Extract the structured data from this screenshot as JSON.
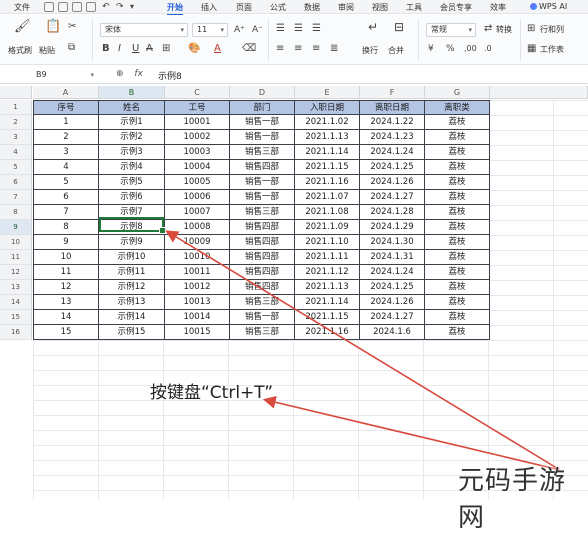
{
  "ribbon_tabs": [
    "文件",
    "开始",
    "插入",
    "页面",
    "公式",
    "数据",
    "审阅",
    "视图",
    "工具",
    "会员专享",
    "效率"
  ],
  "active_tab": "开始",
  "wps_ai": "WPS AI",
  "toolbar": {
    "format_painter": "格式刷",
    "paste": "粘贴",
    "font_name": "宋体",
    "font_size": "11",
    "wrap": "换行",
    "merge": "合并",
    "number_format": "常规",
    "convert": "转换",
    "row_col": "行和列",
    "worksheet": "工作表"
  },
  "formula_bar": {
    "cell_ref": "B9",
    "content": "示例8"
  },
  "columns": [
    "A",
    "B",
    "C",
    "D",
    "E",
    "F",
    "G"
  ],
  "selected_column": "B",
  "row_numbers": [
    "1",
    "2",
    "3",
    "4",
    "5",
    "6",
    "7",
    "8",
    "9",
    "10",
    "11",
    "12",
    "13",
    "14",
    "15",
    "16"
  ],
  "selected_row": "9",
  "table": {
    "headers": [
      "序号",
      "姓名",
      "工号",
      "部门",
      "入职日期",
      "离职日期",
      "离职类"
    ],
    "rows": [
      [
        "1",
        "示例1",
        "10001",
        "销售一部",
        "2021.1.02",
        "2024.1.22",
        "荔枝"
      ],
      [
        "2",
        "示例2",
        "10002",
        "销售一部",
        "2021.1.13",
        "2024.1.23",
        "荔枝"
      ],
      [
        "3",
        "示例3",
        "10003",
        "销售三部",
        "2021.1.14",
        "2024.1.24",
        "荔枝"
      ],
      [
        "4",
        "示例4",
        "10004",
        "销售四部",
        "2021.1.15",
        "2024.1.25",
        "荔枝"
      ],
      [
        "5",
        "示例5",
        "10005",
        "销售一部",
        "2021.1.16",
        "2024.1.26",
        "荔枝"
      ],
      [
        "6",
        "示例6",
        "10006",
        "销售一部",
        "2021.1.07",
        "2024.1.27",
        "荔枝"
      ],
      [
        "7",
        "示例7",
        "10007",
        "销售三部",
        "2021.1.08",
        "2024.1.28",
        "荔枝"
      ],
      [
        "8",
        "示例8",
        "10008",
        "销售四部",
        "2021.1.09",
        "2024.1.29",
        "荔枝"
      ],
      [
        "9",
        "示例9",
        "10009",
        "销售四部",
        "2021.1.10",
        "2024.1.30",
        "荔枝"
      ],
      [
        "10",
        "示例10",
        "10010",
        "销售四部",
        "2021.1.11",
        "2024.1.31",
        "荔枝"
      ],
      [
        "11",
        "示例11",
        "10011",
        "销售四部",
        "2021.1.12",
        "2024.1.24",
        "荔枝"
      ],
      [
        "12",
        "示例12",
        "10012",
        "销售四部",
        "2021.1.13",
        "2024.1.25",
        "荔枝"
      ],
      [
        "13",
        "示例13",
        "10013",
        "销售三部",
        "2021.1.14",
        "2024.1.26",
        "荔枝"
      ],
      [
        "14",
        "示例14",
        "10014",
        "销售一部",
        "2021.1.15",
        "2024.1.27",
        "荔枝"
      ],
      [
        "15",
        "示例15",
        "10015",
        "销售三部",
        "2021.1.16",
        "2024.1.6",
        "荔枝"
      ]
    ]
  },
  "annotation": "按键盘“Ctrl+T”",
  "watermark": "元码手游网",
  "colors": {
    "header_fill": "#b4c5e4",
    "selection": "#1f7a3a",
    "arrow": "#d94a3d",
    "accent": "#2a63d8"
  }
}
